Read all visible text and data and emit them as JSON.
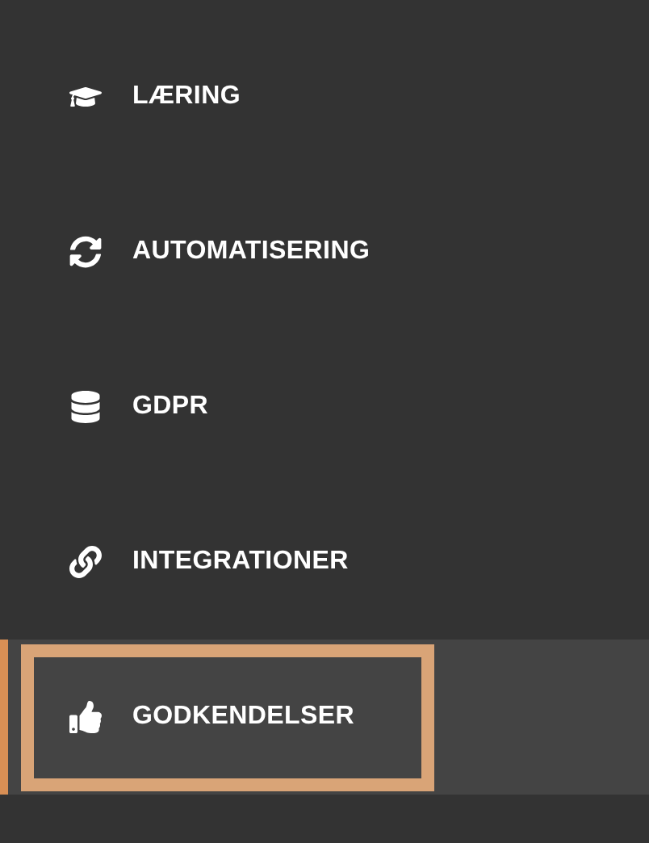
{
  "sidebar": {
    "items": [
      {
        "label": "LÆRING",
        "selected": false,
        "focused": false
      },
      {
        "label": "AUTOMATISERING",
        "selected": false,
        "focused": false
      },
      {
        "label": "GDPR",
        "selected": false,
        "focused": false
      },
      {
        "label": "INTEGRATIONER",
        "selected": false,
        "focused": false
      },
      {
        "label": "GODKENDELSER",
        "selected": true,
        "focused": true
      }
    ]
  }
}
